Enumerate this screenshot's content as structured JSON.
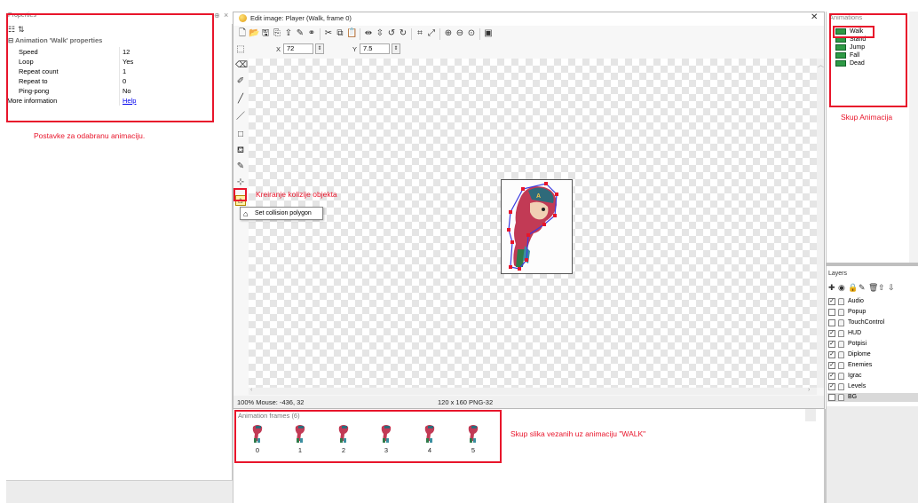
{
  "properties_panel": {
    "title": "Properties",
    "pin_icon": "pin-icon",
    "close_label": "×",
    "category": "Animation 'Walk' properties",
    "rows": [
      {
        "name": "Speed",
        "value": "12"
      },
      {
        "name": "Loop",
        "value": "Yes"
      },
      {
        "name": "Repeat count",
        "value": "1"
      },
      {
        "name": "Repeat to",
        "value": "0"
      },
      {
        "name": "Ping-pong",
        "value": "No"
      }
    ],
    "more_info": {
      "name": "More information",
      "value": "Help"
    }
  },
  "editor": {
    "title": "Edit image: Player (Walk, frame 0)",
    "close_label": "✕",
    "x_label": "X",
    "x_value": "72",
    "y_label": "Y",
    "y_value": "7.5",
    "status_mouse": "100% Mouse: -436, 32",
    "status_size": "120 x 160 PNG-32",
    "tooltip": "Set collision polygon"
  },
  "frames_panel": {
    "title": "Animation frames (6)",
    "frames": [
      "0",
      "1",
      "2",
      "3",
      "4",
      "5"
    ]
  },
  "animations_panel": {
    "title": "Animations",
    "items": [
      "Walk",
      "Stand",
      "Jump",
      "Fall",
      "Dead"
    ]
  },
  "layers_panel": {
    "title": "Layers",
    "layers": [
      {
        "name": "Audio",
        "checked": true
      },
      {
        "name": "Popup",
        "checked": false
      },
      {
        "name": "TouchControl",
        "checked": false
      },
      {
        "name": "HUD",
        "checked": true
      },
      {
        "name": "Potpisi",
        "checked": true
      },
      {
        "name": "Diplome",
        "checked": true
      },
      {
        "name": "Enemies",
        "checked": true
      },
      {
        "name": "Igrac",
        "checked": true
      },
      {
        "name": "Levels",
        "checked": true
      },
      {
        "name": "BG",
        "checked": false
      }
    ]
  },
  "annotations": {
    "properties_note": "Postavke za odabranu animaciju.",
    "collision_note": "Kreiranje kolizije objekta",
    "animations_note": "Skup Animacija",
    "frames_note": "Skup slika vezanih uz animaciju \"WALK\""
  },
  "colors": {
    "annotation_red": "#e8152b",
    "animation_icon_green": "#2e9a45",
    "selected_layer_bg": "#d9d9d9"
  }
}
